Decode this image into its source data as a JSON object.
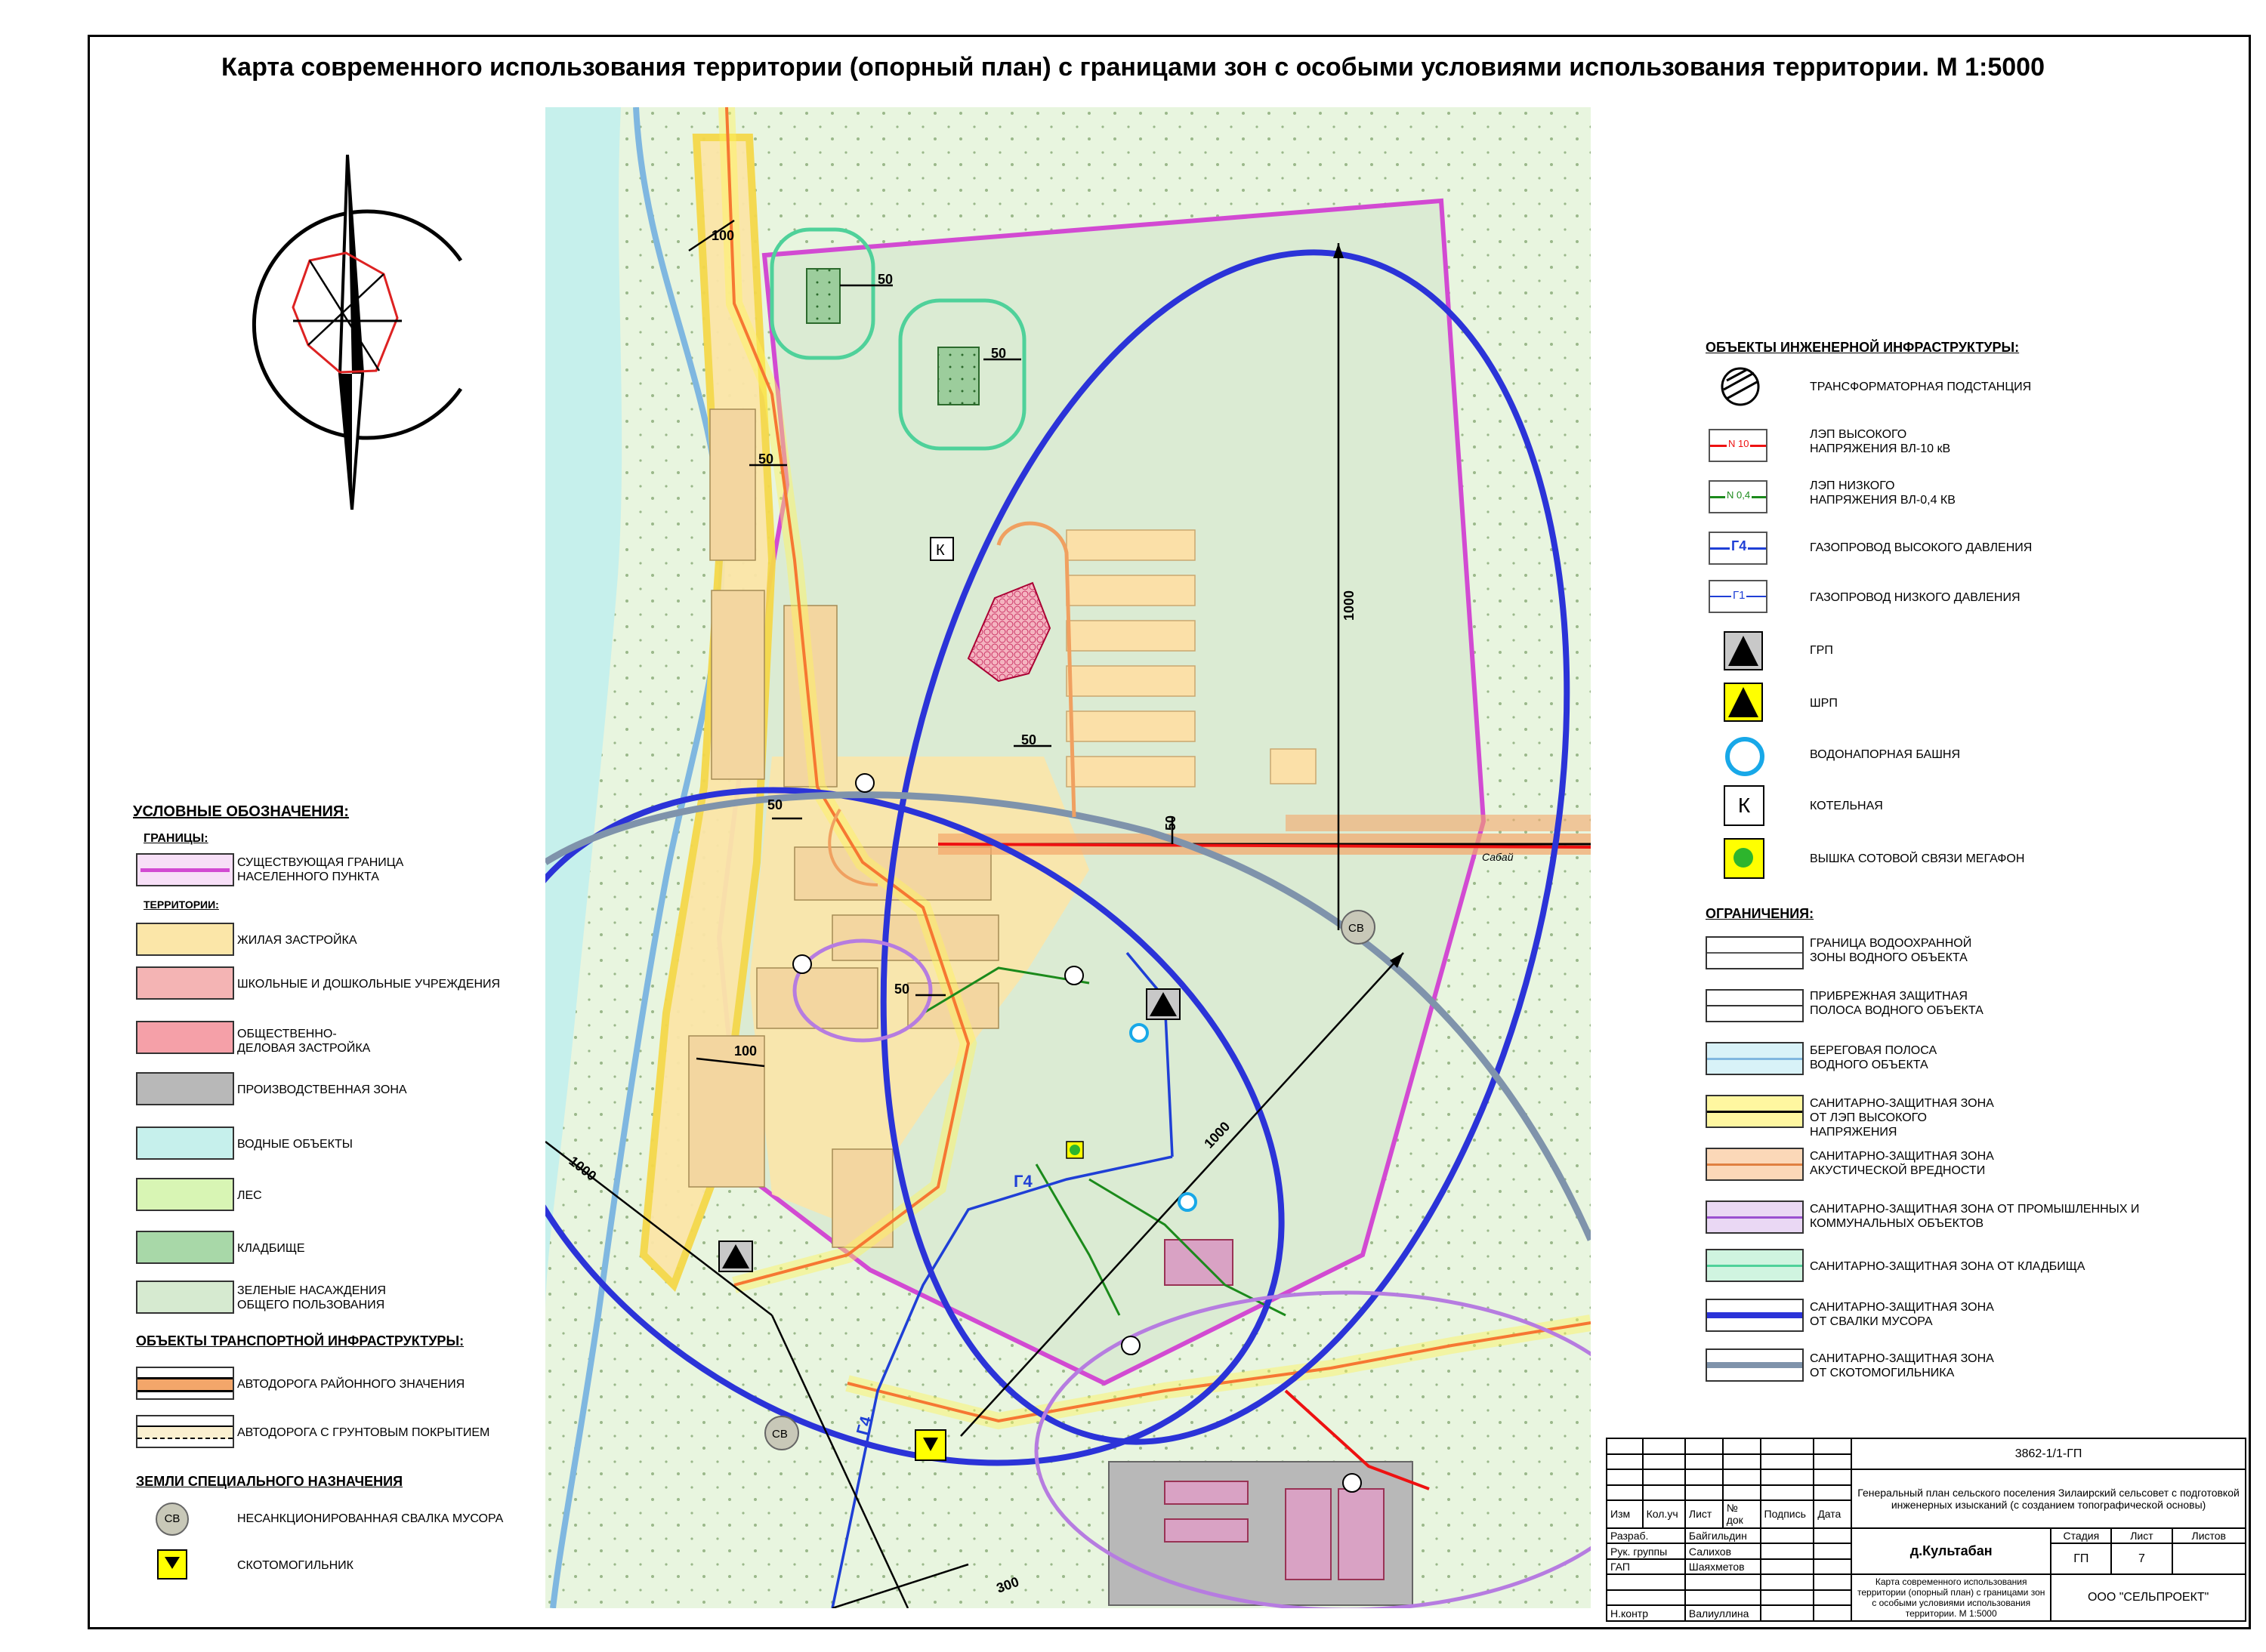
{
  "title": "Карта современного использования территории (опорный план) с границами зон с особыми условиями использования территории. М 1:5000",
  "map_labels": {
    "dist_100_top": "100",
    "dist_50_a": "50",
    "dist_50_b": "50",
    "dist_50_c": "50",
    "dist_50_d": "50",
    "dist_50_e": "50",
    "dist_50_f": "50",
    "dist_50_g": "50",
    "dist_100_mid": "100",
    "dist_1000_right": "1000",
    "dist_1000_diag": "1000",
    "dist_1000_left": "1000",
    "dist_300": "300",
    "kotelnaya_letter": "К",
    "sv_label_1": "СВ",
    "sv_label_2": "СВ",
    "gas_label_1": "Г4",
    "gas_label_2": "Г4",
    "river_label": "Сабай"
  },
  "legend_left": {
    "heading": "УСЛОВНЫЕ ОБОЗНАЧЕНИЯ:",
    "boundaries_heading": "ГРАНИЦЫ:",
    "boundary_item": "СУЩЕСТВУЮЩАЯ ГРАНИЦА НАСЕЛЕННОГО ПУНКТА",
    "territories_heading": "ТЕРРИТОРИИ:",
    "territory_items": [
      {
        "label": "ЖИЛАЯ ЗАСТРОЙКА",
        "color": "#fbe6a8"
      },
      {
        "label": "ШКОЛЬНЫЕ И ДОШКОЛЬНЫЕ УЧРЕЖДЕНИЯ",
        "color": "#f4b4b4"
      },
      {
        "label": "ОБЩЕСТВЕННО-ДЕЛОВАЯ ЗАСТРОЙКА",
        "color": "#f5a0a8"
      },
      {
        "label": "ПРОИЗВОДСТВЕННАЯ ЗОНА",
        "color": "#b8b8b8"
      },
      {
        "label": "ВОДНЫЕ ОБЪЕКТЫ",
        "color": "#c6f0ec"
      },
      {
        "label": "ЛЕС",
        "color": "#d8f5b4"
      },
      {
        "label": "КЛАДБИЩЕ",
        "color": "#a8d8a8"
      },
      {
        "label": "ЗЕЛЕНЫЕ НАСАЖДЕНИЯ ОБЩЕГО ПОЛЬЗОВАНИЯ",
        "color": "#d6ead0"
      }
    ],
    "transport_heading": "ОБЪЕКТЫ ТРАНСПОРТНОЙ ИНФРАСТРУКТУРЫ:",
    "transport_items": [
      "АВТОДОРОГА РАЙОННОГО ЗНАЧЕНИЯ",
      "АВТОДОРОГА С ГРУНТОВЫМ ПОКРЫТИЕМ"
    ],
    "special_heading": "ЗЕМЛИ СПЕЦИАЛЬНОГО НАЗНАЧЕНИЯ",
    "special_items": [
      {
        "symbol": "СВ",
        "label": "НЕСАНКЦИОНИРОВАННАЯ СВАЛКА МУСОРА"
      },
      {
        "label": "СКОТОМОГИЛЬНИК"
      }
    ]
  },
  "legend_right": {
    "infra_heading": "ОБЪЕКТЫ ИНЖЕНЕРНОЙ ИНФРАСТРУКТУРЫ:",
    "infra_items": [
      {
        "label": "ТРАНСФОРМАТОРНАЯ ПОДСТАНЦИЯ"
      },
      {
        "symbol": "N 10",
        "label": "ЛЭП ВЫСОКОГО НАПРЯЖЕНИЯ ВЛ-10 кВ"
      },
      {
        "symbol": "N 0,4",
        "label": "ЛЭП НИЗКОГО НАПРЯЖЕНИЯ ВЛ-0,4 КВ"
      },
      {
        "symbol": "Г4",
        "label": "ГАЗОПРОВОД ВЫСОКОГО ДАВЛЕНИЯ"
      },
      {
        "symbol": "Г1",
        "label": "ГАЗОПРОВОД НИЗКОГО ДАВЛЕНИЯ"
      },
      {
        "label": "ГРП"
      },
      {
        "label": "ШРП"
      },
      {
        "label": "ВОДОНАПОРНАЯ БАШНЯ"
      },
      {
        "symbol": "К",
        "label": "КОТЕЛЬНАЯ"
      },
      {
        "label": "ВЫШКА СОТОВОЙ СВЯЗИ МЕГАФОН"
      }
    ],
    "restrictions_heading": "ОГРАНИЧЕНИЯ:",
    "restriction_items": [
      {
        "label": "ГРАНИЦА ВОДООХРАННОЙ ЗОНЫ ВОДНОГО ОБЪЕКТА"
      },
      {
        "label": "ПРИБРЕЖНАЯ ЗАЩИТНАЯ ПОЛОСА ВОДНОГО ОБЪЕКТА"
      },
      {
        "label": "БЕРЕГОВАЯ ПОЛОСА ВОДНОГО ОБЪЕКТА"
      },
      {
        "label": "САНИТАРНО-ЗАЩИТНАЯ ЗОНА ОТ ЛЭП ВЫСОКОГО НАПРЯЖЕНИЯ"
      },
      {
        "label": "САНИТАРНО-ЗАЩИТНАЯ ЗОНА АКУСТИЧЕСКОЙ ВРЕДНОСТИ"
      },
      {
        "label": "САНИТАРНО-ЗАЩИТНАЯ ЗОНА ОТ ПРОМЫШЛЕННЫХ И КОММУНАЛЬНЫХ ОБЪЕКТОВ"
      },
      {
        "label": "САНИТАРНО-ЗАЩИТНАЯ ЗОНА ОТ КЛАДБИЩА"
      },
      {
        "label": "САНИТАРНО-ЗАЩИТНАЯ ЗОНА ОТ СВАЛКИ МУСОРА"
      },
      {
        "label": "САНИТАРНО-ЗАЩИТНАЯ ЗОНА ОТ СКОТОМОГИЛЬНИКА"
      }
    ]
  },
  "stamp": {
    "code": "3862-1/1-ГП",
    "project_title": "Генеральный план сельского поселения Зилаирский сельсовет с подготовкой инженерных изысканий (с созданием топографической основы)",
    "col_headers": [
      "Изм",
      "Кол.уч",
      "Лист",
      "№ док",
      "Подпись",
      "Дата"
    ],
    "roles": [
      "Разраб.",
      "Рук. группы",
      "ГАП",
      "",
      "Н.контр"
    ],
    "names": [
      "Байгильдин",
      "Салихов",
      "Шаяхметов",
      "",
      "Валиуллина"
    ],
    "place": "д.Культабан",
    "stage_header": "Стадия",
    "sheet_header": "Лист",
    "sheets_header": "Листов",
    "stage": "ГП",
    "sheet": "7",
    "sheets": "",
    "sheet_title": "Карта современного использования территории (опорный план) с границами зон с особыми условиями использования территории. М 1:5000",
    "company": "ООО \"СЕЛЬПРОЕКТ\""
  }
}
